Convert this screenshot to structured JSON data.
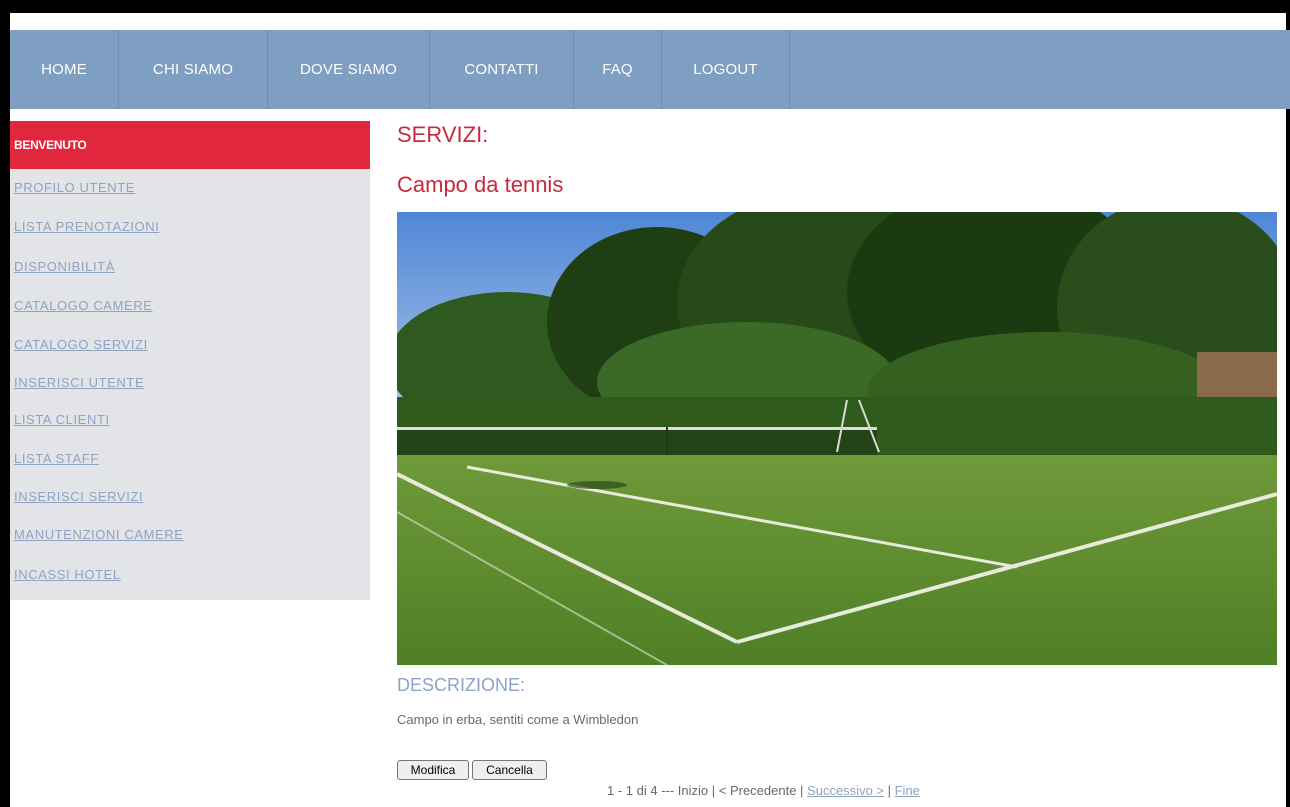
{
  "nav": {
    "items": [
      "HOME",
      "CHI SIAMO",
      "DOVE SIAMO",
      "CONTATTI",
      "FAQ",
      "LOGOUT"
    ]
  },
  "sidebar": {
    "header": "BENVENUTO",
    "links": [
      "PROFILO UTENTE",
      "LISTA PRENOTAZIONI",
      "DISPONIBILITÀ",
      "CATALOGO CAMERE",
      "CATALOGO SERVIZI",
      "INSERISCI UTENTE",
      "LISTA CLIENTI",
      "LISTA STAFF",
      "INSERISCI SERVIZI",
      "MANUTENZIONI CAMERE",
      "INCASSI HOTEL"
    ]
  },
  "main": {
    "section_title": "SERVIZI:",
    "service_name": "Campo da tennis",
    "description_label": "DESCRIZIONE:",
    "description_text": "Campo in erba, sentiti come a Wimbledon",
    "buttons": {
      "edit": "Modifica",
      "delete": "Cancella"
    },
    "pager": {
      "summary": "1 - 1 di 4 --- Inizio | < Precedente | ",
      "next": "Successivo >",
      "separator": " | ",
      "last": "Fine"
    }
  },
  "colors": {
    "nav_bg": "#7e9ec2",
    "sidebar_header_bg": "#e0273c",
    "sidebar_bg": "#e2e4e8",
    "title_red": "#c72a3c",
    "link_blue": "#8fa3c2"
  }
}
